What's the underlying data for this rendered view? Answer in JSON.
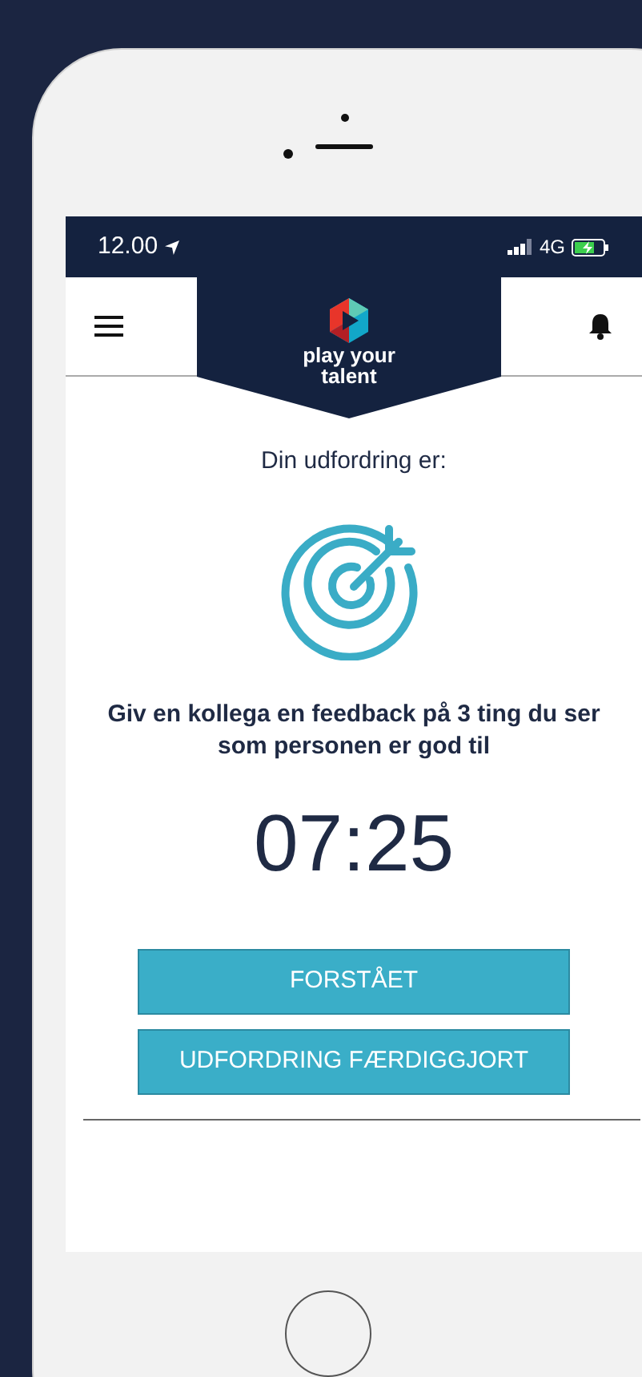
{
  "status_bar": {
    "time": "12.00",
    "network": "4G"
  },
  "header": {
    "logo_lines": [
      "play your",
      "talent"
    ]
  },
  "challenge": {
    "intro": "Din udfordring er:",
    "task": "Giv en kollega en feedback på 3 ting du ser som personen er god til",
    "timer": "07:25"
  },
  "buttons": [
    {
      "label": "FORSTÅET"
    },
    {
      "label": "UDFORDRING FÆRDIGGJORT"
    }
  ]
}
